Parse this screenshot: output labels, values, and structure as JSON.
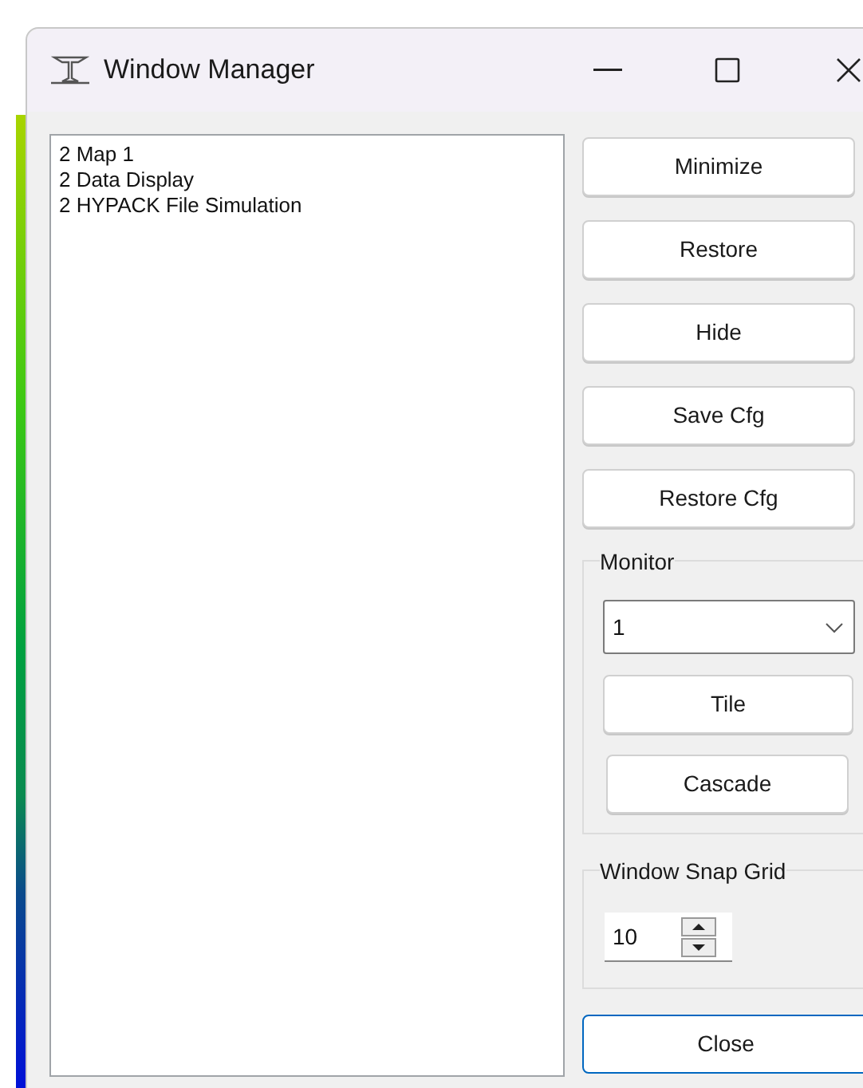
{
  "window": {
    "title": "Window Manager"
  },
  "window_list": [
    {
      "label": "2 Map 1"
    },
    {
      "label": "2 Data Display"
    },
    {
      "label": "2 HYPACK File Simulation"
    }
  ],
  "buttons": [
    {
      "label": "Minimize"
    },
    {
      "label": "Restore"
    },
    {
      "label": "Hide"
    },
    {
      "label": "Save Cfg"
    },
    {
      "label": "Restore Cfg"
    }
  ],
  "monitor": {
    "title": "Monitor",
    "value": "1",
    "buttons": [
      {
        "label": "Tile"
      },
      {
        "label": "Cascade"
      }
    ]
  },
  "snap_grid": {
    "title": "Window Snap Grid",
    "value": "10"
  },
  "close_button": {
    "label": "Close",
    "focused": true
  }
}
